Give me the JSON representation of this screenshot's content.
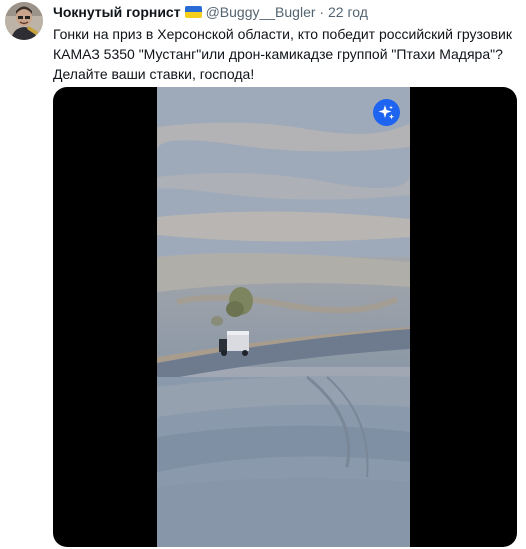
{
  "author": {
    "name": "Чокнутый горнист",
    "flag_icon": "ukraine-flag-icon",
    "handle": "@Buggy__Bugler",
    "separator": "·",
    "time": "22 год"
  },
  "tweet": {
    "line1": "Гонки на приз в Херсонской области, кто победит российский грузовик",
    "line2": "КАМАЗ 5350 \"Мустанг\"или дрон-камикадзе группой \"Птахи Мадяра\"?",
    "line3": "Делайте ваши ставки, господа!"
  },
  "media": {
    "type": "video",
    "badge_icon": "sparkle-icon",
    "colors": {
      "badge": "#1d64f0",
      "letterbox": "#000000"
    }
  }
}
